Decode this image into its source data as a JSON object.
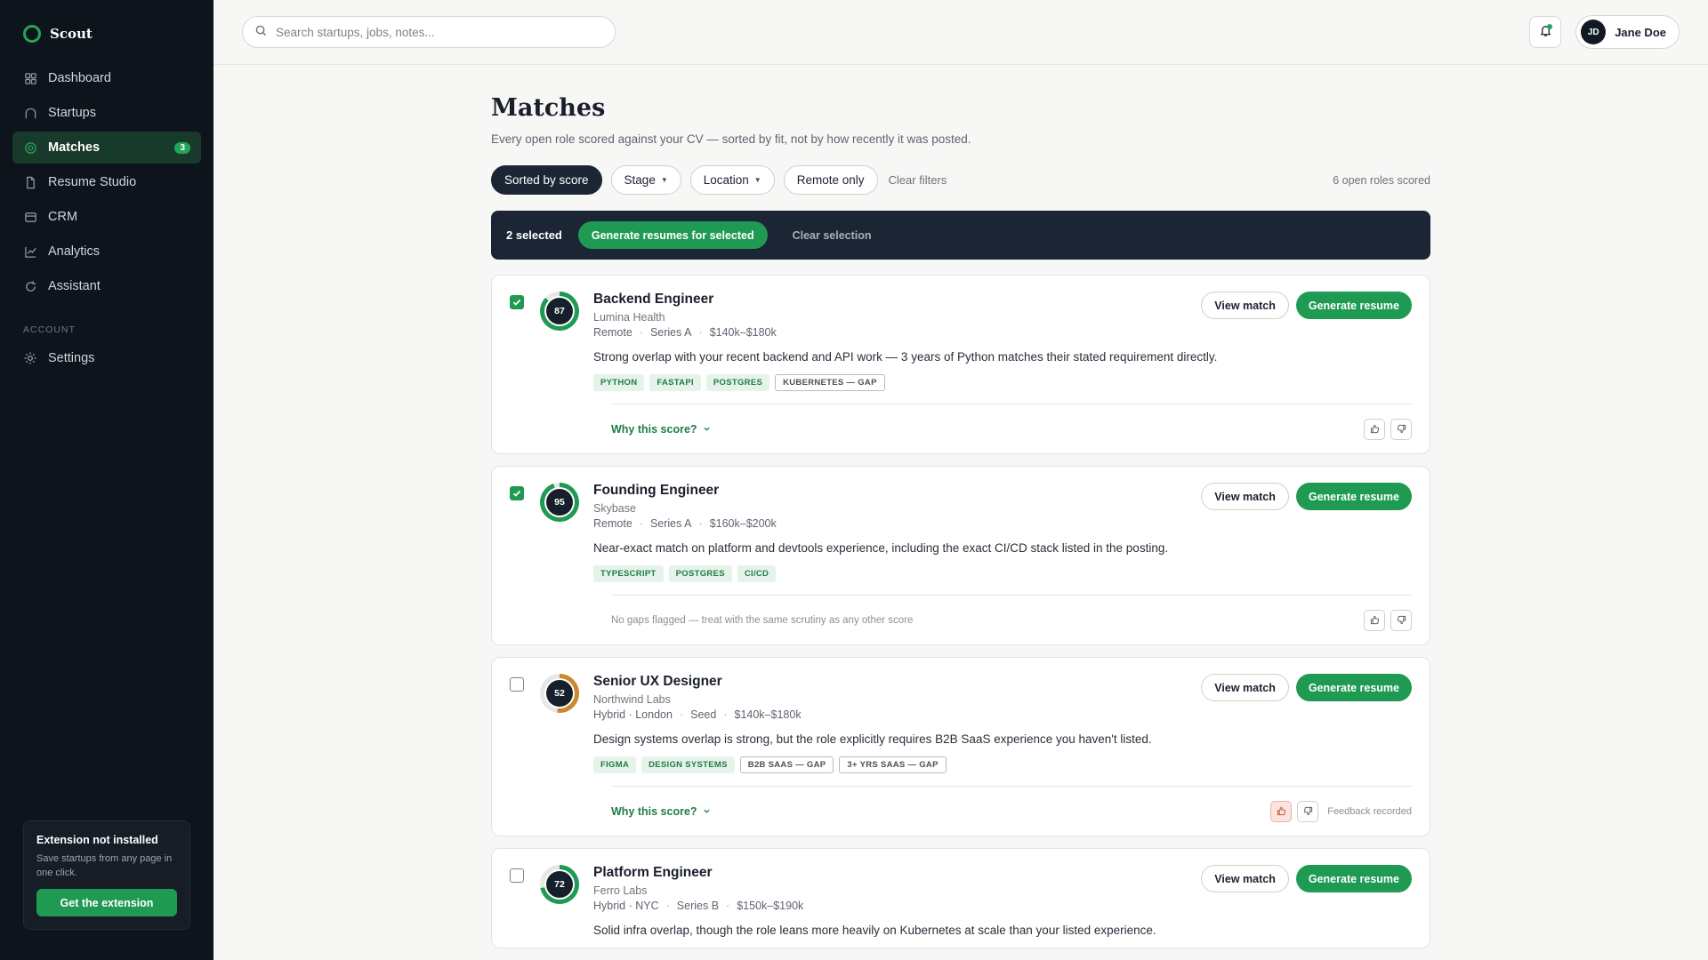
{
  "brand": {
    "name": "Scout"
  },
  "sidebar": {
    "items": [
      {
        "label": "Dashboard",
        "icon": "grid-icon"
      },
      {
        "label": "Startups",
        "icon": "home-icon"
      },
      {
        "label": "Matches",
        "icon": "target-icon",
        "badge": "3",
        "active": true
      },
      {
        "label": "Resume Studio",
        "icon": "file-icon"
      },
      {
        "label": "CRM",
        "icon": "card-icon"
      },
      {
        "label": "Analytics",
        "icon": "chart-icon"
      },
      {
        "label": "Assistant",
        "icon": "refresh-icon"
      }
    ],
    "account_label": "ACCOUNT",
    "settings_label": "Settings",
    "extension": {
      "title": "Extension not installed",
      "desc": "Save startups from any page in one click.",
      "button": "Get the extension"
    }
  },
  "topbar": {
    "search_placeholder": "Search startups, jobs, notes...",
    "user_initials": "JD",
    "user_name": "Jane Doe"
  },
  "page": {
    "title": "Matches",
    "subtitle": "Every open role scored against your CV — sorted by fit, not by how recently it was posted.",
    "filters": {
      "sorted": "Sorted by score",
      "stage": "Stage",
      "location": "Location",
      "remote": "Remote only",
      "clear": "Clear filters",
      "count": "6 open roles scored"
    },
    "selection": {
      "count": "2 selected",
      "generate": "Generate resumes for selected",
      "clear": "Clear selection"
    }
  },
  "colors": {
    "accent": "#1f9a53",
    "dark": "#1b2533",
    "warn": "#c98a2b"
  },
  "buttons": {
    "view": "View match",
    "generate": "Generate resume",
    "why": "Why this score?"
  },
  "cards": [
    {
      "checked": true,
      "score": "87",
      "score_pct": 87,
      "ring_color": "#1f9a53",
      "title": "Backend Engineer",
      "company": "Lumina Health",
      "meta": [
        "Remote",
        "Series A",
        "$140k–$180k"
      ],
      "summary": "Strong overlap with your recent backend and API work — 3 years of Python matches their stated requirement directly.",
      "tags": [
        {
          "text": "PYTHON",
          "kind": "match"
        },
        {
          "text": "FASTAPI",
          "kind": "match"
        },
        {
          "text": "POSTGRES",
          "kind": "match"
        },
        {
          "text": "KUBERNETES — GAP",
          "kind": "gap"
        }
      ],
      "footer": "why",
      "feedback": ""
    },
    {
      "checked": true,
      "score": "95",
      "score_pct": 95,
      "ring_color": "#1f9a53",
      "title": "Founding Engineer",
      "company": "Skybase",
      "meta": [
        "Remote",
        "Series A",
        "$160k–$200k"
      ],
      "summary": "Near-exact match on platform and devtools experience, including the exact CI/CD stack listed in the posting.",
      "tags": [
        {
          "text": "TYPESCRIPT",
          "kind": "match"
        },
        {
          "text": "POSTGRES",
          "kind": "match"
        },
        {
          "text": "CI/CD",
          "kind": "match"
        }
      ],
      "footer": "note",
      "note": "No gaps flagged — treat with the same scrutiny as any other score",
      "feedback": ""
    },
    {
      "checked": false,
      "score": "52",
      "score_pct": 52,
      "ring_color": "#c98a2b",
      "title": "Senior UX Designer",
      "company": "Northwind Labs",
      "meta": [
        "Hybrid · London",
        "Seed",
        "$140k–$180k"
      ],
      "summary": "Design systems overlap is strong, but the role explicitly requires B2B SaaS experience you haven't listed.",
      "tags": [
        {
          "text": "FIGMA",
          "kind": "match"
        },
        {
          "text": "DESIGN SYSTEMS",
          "kind": "match"
        },
        {
          "text": "B2B SAAS — GAP",
          "kind": "gap"
        },
        {
          "text": "3+ YRS SAAS — GAP",
          "kind": "gap"
        }
      ],
      "footer": "why",
      "feedback": "Feedback recorded",
      "thumb_up_active": true
    },
    {
      "checked": false,
      "score": "72",
      "score_pct": 72,
      "ring_color": "#1f9a53",
      "title": "Platform Engineer",
      "company": "Ferro Labs",
      "meta": [
        "Hybrid · NYC",
        "Series B",
        "$150k–$190k"
      ],
      "summary": "Solid infra overlap, though the role leans more heavily on Kubernetes at scale than your listed experience.",
      "tags": [],
      "footer": "none",
      "feedback": ""
    }
  ]
}
